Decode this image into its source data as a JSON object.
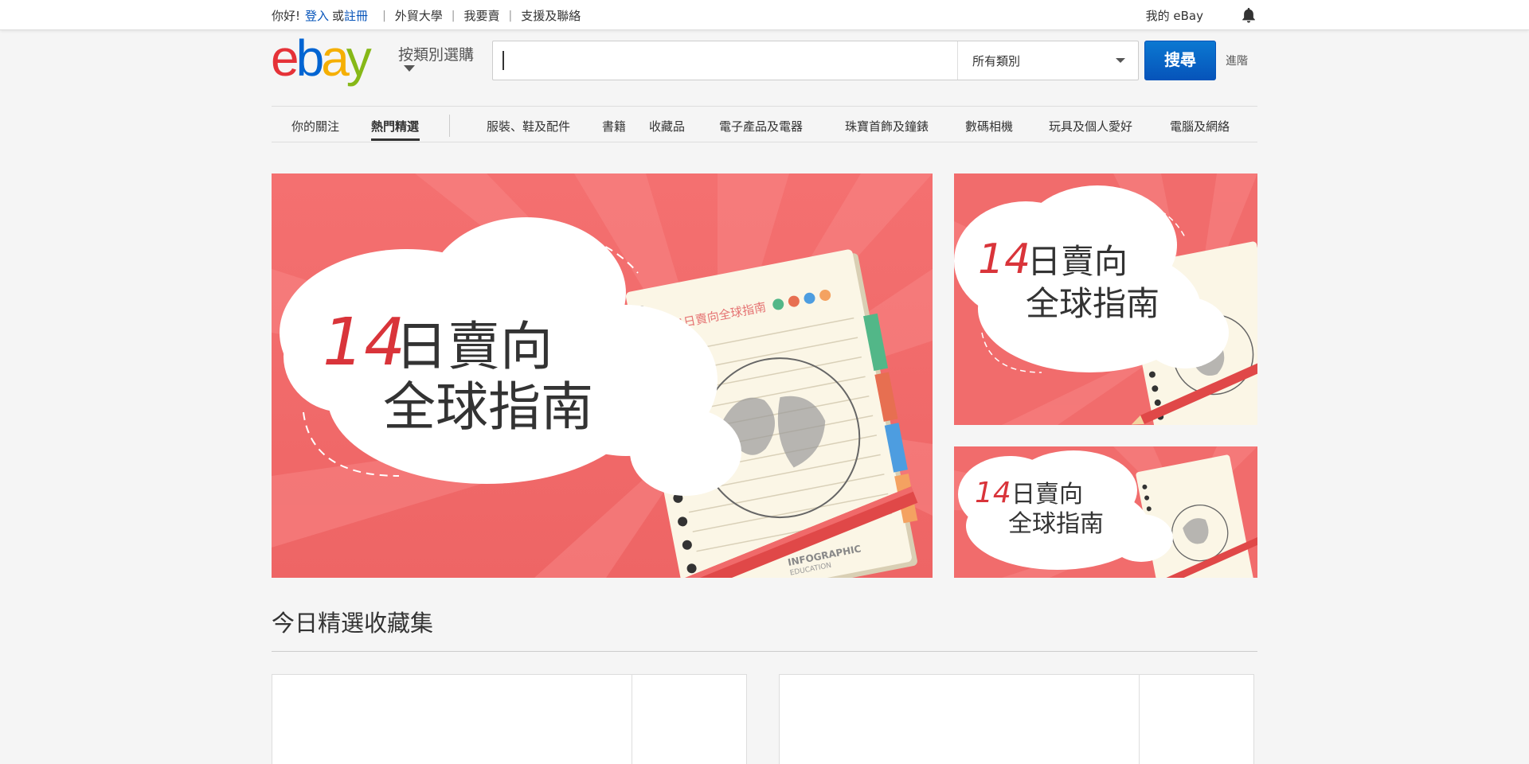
{
  "topbar": {
    "greeting": "你好!",
    "signin": "登入",
    "or": "或",
    "register": "註冊",
    "links": [
      "外貿大學",
      "我要賣",
      "支援及聯絡"
    ],
    "my_ebay": "我的 eBay"
  },
  "header": {
    "logo": "ebay",
    "shop_by_category": "按類別選購",
    "search": {
      "value": "",
      "placeholder": ""
    },
    "category_select": "所有類別",
    "search_button": "搜尋",
    "advanced": "進階"
  },
  "catnav": {
    "items": [
      "你的關注",
      "熱門精選",
      "服裝、鞋及配件",
      "書籍",
      "收藏品",
      "電子產品及電器",
      "珠寶首飾及鐘錶",
      "數碼相機",
      "玩具及個人愛好",
      "電腦及網絡"
    ],
    "active_index": 1
  },
  "banners": {
    "number": "14",
    "line1": "日賣向",
    "line2": "全球指南",
    "notebook_title": "14日賣向全球指南",
    "notebook_brand": "INFOGRAPHIC",
    "notebook_sub": "EDUCATION"
  },
  "collections": {
    "title": "今日精選收藏集"
  },
  "colors": {
    "banner_bg": "#f16c6c",
    "accent_red": "#e53238",
    "link_blue": "#0654ba"
  }
}
